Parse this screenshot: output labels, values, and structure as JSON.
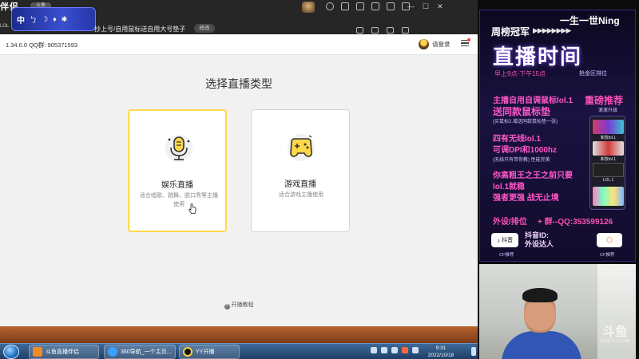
{
  "top": {
    "app_logo": "伴侣",
    "logo_badge": "斗鱼",
    "lol_prefix": "LOL",
    "ime_label": "中",
    "ime_symbols": [
      "ㄅ",
      "☽",
      "♦",
      "✱"
    ],
    "subtitle": "抄上号/自用鼠标送自用大号垫子",
    "modify_label": "修改",
    "window_controls": [
      "—",
      "☐",
      "✕"
    ]
  },
  "client": {
    "version": "1.34.0.0  QQ群: 905371593",
    "login_label": "请登录",
    "page_title": "选择直播类型",
    "cards": [
      {
        "title": "娱乐直播",
        "desc": "适合唱歌、跳舞、脱口秀等主播使用",
        "selected": true,
        "icon": "microphone-icon"
      },
      {
        "title": "游戏直播",
        "desc": "适合游戏主播使用",
        "selected": false,
        "icon": "gamepad-icon"
      }
    ],
    "tutorial": "开播教程"
  },
  "taskbar": {
    "items": [
      {
        "label": "斗鱼直播伴侣",
        "icon": "douyu-icon",
        "color": "#f08a24"
      },
      {
        "label": "360导航_一个主页...",
        "icon": "browser-360-icon",
        "color": "#3aa0ff"
      },
      {
        "label": "YY开播",
        "icon": "yy-icon",
        "color": "#ffd23a"
      }
    ],
    "time": "9:31",
    "date": "2022/10/18"
  },
  "poster": {
    "name": "一生一世Ning",
    "logo": "周榜冠军",
    "arrows": "▶▶▶▶▶▶▶▶",
    "title": "直播时间",
    "time": "早上9点-下午15点",
    "area": "抢金区排位",
    "line1": "主播自用自调鼠标lol.1",
    "line2": "送同款鼠标垫",
    "line2_sub": "(买鼠标2.增送同款鼠标垫一张)",
    "line3": "四有无线lol.1",
    "line4": "可调DPI和1000hz",
    "line4_sub": "(无线只有带你教) 性能完美",
    "line5": "你高粗王之王之前只要",
    "line6": "lol.1就稳",
    "line7": "强者更强 战无止境",
    "recommend": "重磅推荐",
    "recommend_sub": "滚滚升级",
    "mouse_labels": [
      "新款lol.1",
      "新款lol.1",
      "LOL.1"
    ],
    "contact": "外设/排位",
    "contact2": "+ 群--QQ:353599126",
    "douyin_label": "抖音",
    "douyin_id": "抖音ID:\n外设达人",
    "follow_label": "关注",
    "foot_left": "CF推荐",
    "foot_right": "CF推荐"
  },
  "cam": {
    "watermark_big": "斗鱼",
    "watermark_small": "DOUYU.COM"
  }
}
